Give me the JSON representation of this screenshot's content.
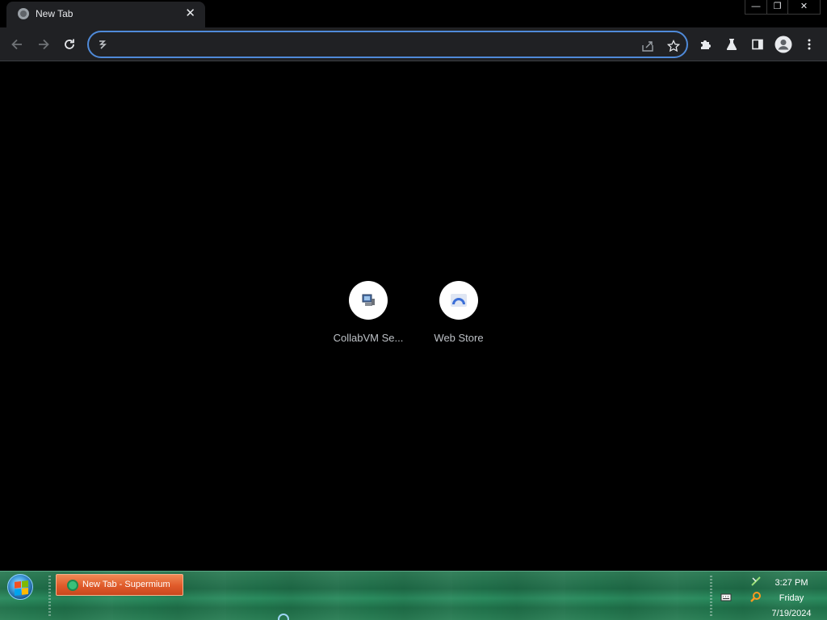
{
  "browser": {
    "tab": {
      "title": "New Tab",
      "close_glyph": "✕",
      "favicon": "globe-icon"
    },
    "window_controls": {
      "minimize": "—",
      "restore": "❐",
      "close": "✕"
    },
    "toolbar": {
      "back_icon": "back-arrow-icon",
      "forward_icon": "forward-arrow-icon",
      "reload_icon": "reload-icon",
      "omnibox": {
        "value": "",
        "placeholder": "",
        "site_icon": "search-engine-icon"
      },
      "share_icon": "share-icon",
      "bookmark_icon": "star-icon",
      "extensions_icon": "puzzle-icon",
      "labs_icon": "flask-icon",
      "side_panel_icon": "side-panel-icon",
      "profile_icon": "profile-avatar-icon",
      "menu_icon": "kebab-menu-icon"
    },
    "accent_color": "#4f8ad9"
  },
  "new_tab_page": {
    "shortcuts": [
      {
        "label": "CollabVM Se...",
        "icon": "collabvm-computer-icon"
      },
      {
        "label": "Web Store",
        "icon": "web-store-icon"
      }
    ]
  },
  "taskbar": {
    "start_icon": "windows-start-orb",
    "task_button": {
      "label": "New Tab - Supermium",
      "icon": "supermium-icon"
    },
    "tray": {
      "network_icon": "network-icon",
      "search_icon": "magnifier-icon",
      "keyboard_icon": "keyboard-icon"
    },
    "clock": {
      "time": "3:27 PM",
      "day": "Friday",
      "date": "7/19/2024"
    },
    "color": "#1e6b47"
  }
}
